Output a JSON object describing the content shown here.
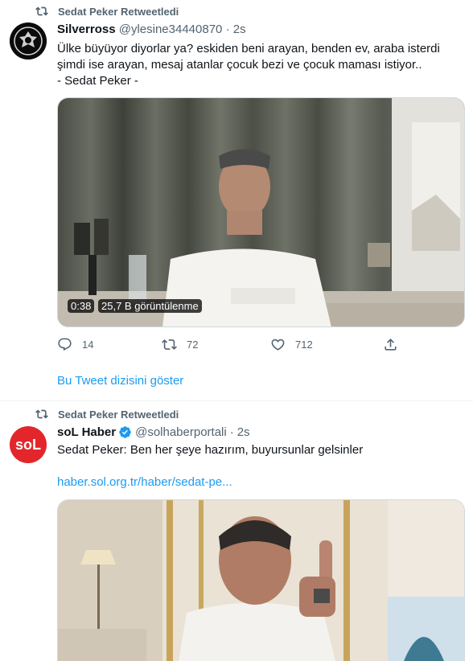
{
  "tweet1": {
    "retweet_label": "Sedat Peker Retweetledi",
    "name": "Silverross",
    "handle": "@ylesine34440870",
    "separator": "·",
    "time": "2s",
    "text": "Ülke büyüyor diyorlar ya? eskiden beni arayan, benden ev, araba isterdi\nşimdi ise arayan, mesaj atanlar çocuk bezi ve çocuk maması istiyor..\n- Sedat Peker -",
    "video_duration": "0:38",
    "video_views": "25,7 B görüntülenme",
    "reply_count": "14",
    "retweet_count": "72",
    "like_count": "712",
    "show_thread": "Bu Tweet dizisini göster"
  },
  "tweet2": {
    "retweet_label": "Sedat Peker Retweetledi",
    "name": "soL Haber",
    "handle": "@solhaberportali",
    "separator": "·",
    "time": "2s",
    "text": "Sedat Peker: Ben her şeye hazırım, buyursunlar gelsinler",
    "link": "haber.sol.org.tr/haber/sedat-pe...",
    "avatar_text": "soL"
  },
  "colors": {
    "accent": "#1d9bf0",
    "muted": "#536471",
    "sol_red": "#e3262b"
  }
}
